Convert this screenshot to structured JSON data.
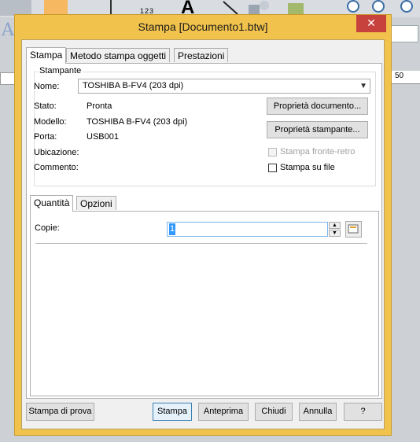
{
  "background": {
    "toolbar_label": "123",
    "toolbar_letter": "A",
    "ruler_number": "50"
  },
  "dialog": {
    "title": "Stampa [Documento1.btw]",
    "close_glyph": "✕",
    "tabs": [
      {
        "label": "Stampa",
        "active": true
      },
      {
        "label": "Metodo stampa oggetti",
        "active": false
      },
      {
        "label": "Prestazioni",
        "active": false
      }
    ],
    "printer": {
      "group_label": "Stampante",
      "name_label": "Nome:",
      "name_value": "TOSHIBA B-FV4 (203 dpi)",
      "status_label": "Stato:",
      "status_value": "Pronta",
      "model_label": "Modello:",
      "model_value": "TOSHIBA B-FV4 (203 dpi)",
      "port_label": "Porta:",
      "port_value": "USB001",
      "location_label": "Ubicazione:",
      "comment_label": "Commento:",
      "doc_props_button": "Proprietà documento...",
      "printer_props_button": "Proprietà stampante...",
      "duplex_label": "Stampa fronte-retro",
      "print_to_file_label": "Stampa su file"
    },
    "inner_tabs": [
      {
        "label": "Quantità",
        "active": true
      },
      {
        "label": "Opzioni",
        "active": false
      }
    ],
    "copies": {
      "label": "Copie:",
      "value": "1"
    },
    "footer": {
      "test_print": "Stampa di prova",
      "print": "Stampa",
      "preview": "Anteprima",
      "close": "Chiudi",
      "cancel": "Annulla",
      "help": "?"
    }
  },
  "colors": {
    "window_frame": "#f1c34c",
    "close_button": "#c7423d",
    "selection": "#3399ff"
  }
}
